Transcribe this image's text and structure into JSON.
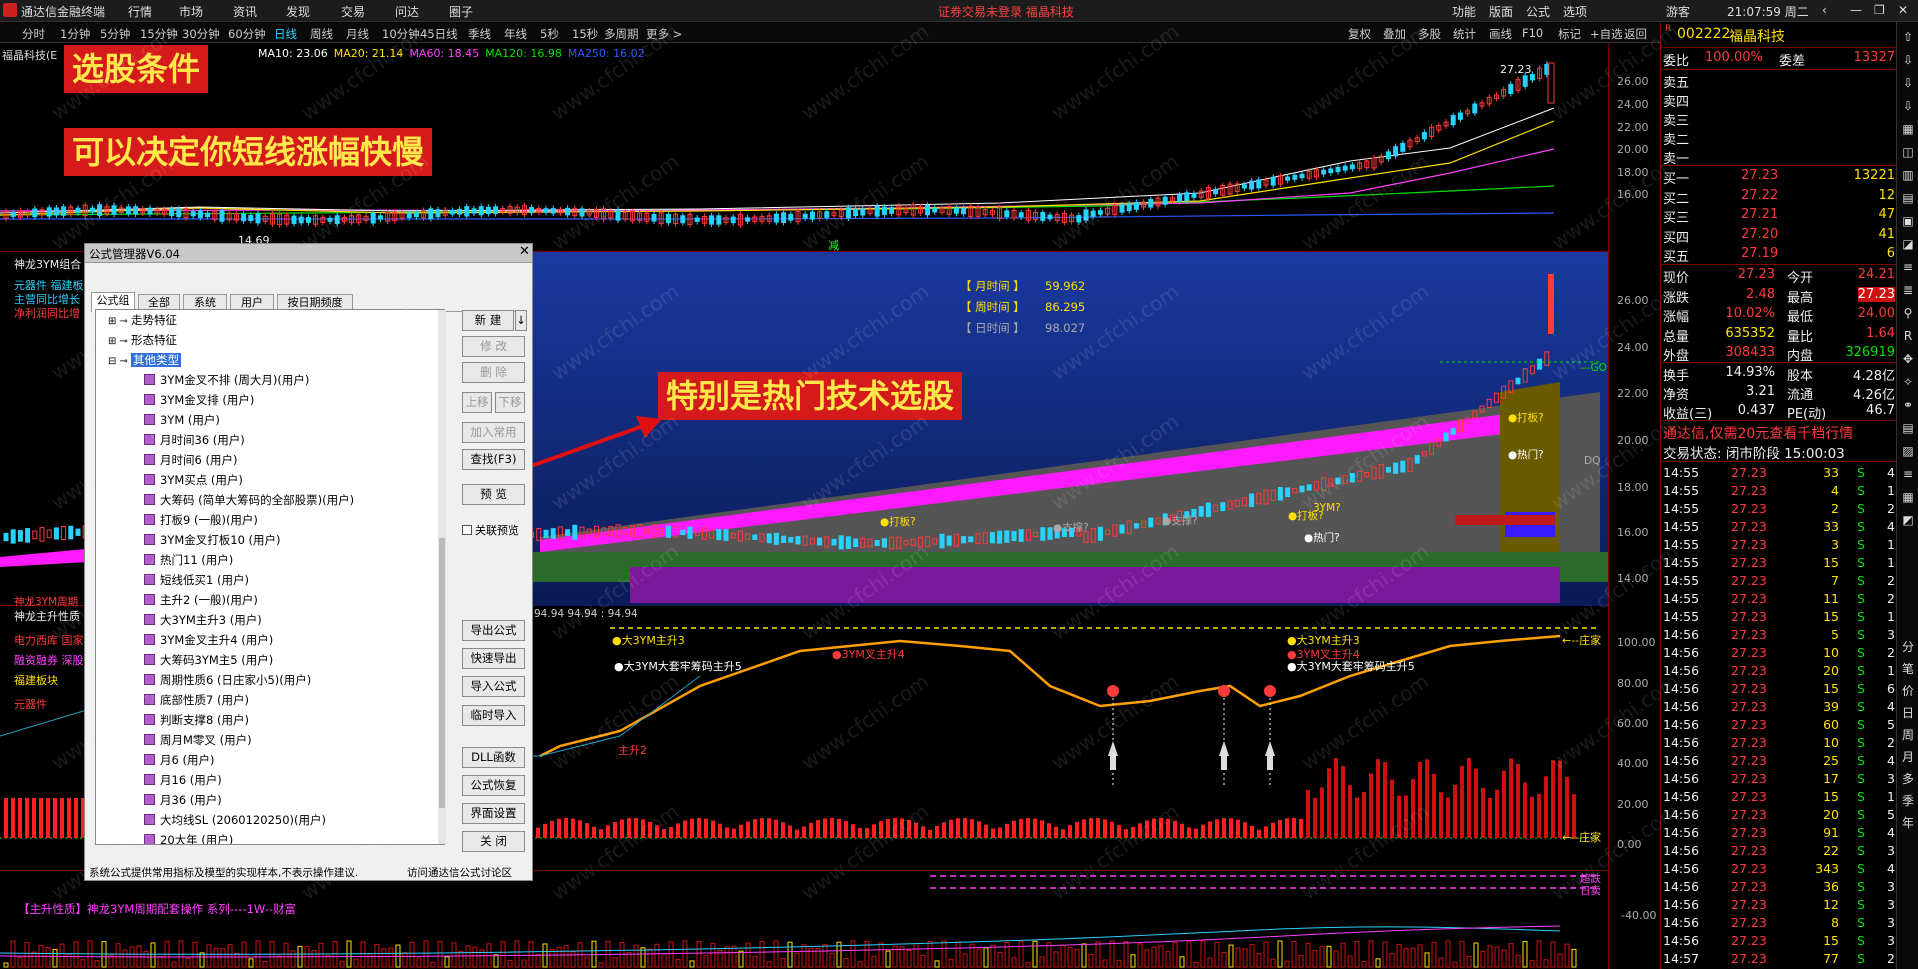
{
  "app": {
    "title": "通达信金融终端",
    "menu": [
      "行情",
      "市场",
      "资讯",
      "发现",
      "交易",
      "问达",
      "圈子"
    ],
    "center_notice": "证券交易未登录  福晶科技",
    "right_menu": [
      "功能",
      "版面",
      "公式",
      "选项"
    ],
    "user": "游客",
    "clock": "21:07:59 周二"
  },
  "periods": [
    "分时",
    "1分钟",
    "5分钟",
    "15分钟",
    "30分钟",
    "60分钟",
    "日线",
    "周线",
    "月线",
    "10分钟",
    "45日线",
    "季线",
    "年线",
    "5秒",
    "15秒",
    "多周期",
    "更多 >"
  ],
  "active_period": "日线",
  "toolbar_right": [
    "复权",
    "叠加",
    "多股",
    "统计",
    "画线",
    "F10",
    "标记",
    "+自选",
    "返回"
  ],
  "main_chart": {
    "legend_stock": "福晶科技(E",
    "ma_legend": [
      {
        "text": "MA10: 23.06",
        "color": "#ffffff"
      },
      {
        "text": "MA20: 21.14",
        "color": "#ffe000"
      },
      {
        "text": "MA60: 18.45",
        "color": "#ff40ff"
      },
      {
        "text": "MA120: 16.98",
        "color": "#00e000"
      },
      {
        "text": "MA250: 16.02",
        "color": "#2a5aff"
      }
    ],
    "y_ticks": [
      "26.00",
      "24.00",
      "22.00",
      "20.00",
      "18.00",
      "16.00"
    ],
    "high_label": "27.23",
    "low_label": "14.69",
    "reduce_mark": "减"
  },
  "panel2": {
    "title": "神龙3YM组合",
    "info_lines": [
      "元器件 福建板",
      "主营同比增长",
      "净利润同比增"
    ],
    "time_labels": [
      {
        "name": "【 月时间 】",
        "value": "59.962",
        "color": "#ffe000"
      },
      {
        "name": "【 周时间 】",
        "value": "86.295",
        "color": "#ffe000"
      },
      {
        "name": "【 日时间 】",
        "value": "98.027",
        "color": "#aaaaaa"
      }
    ],
    "y_ticks": [
      "26.00",
      "24.00",
      "22.00",
      "20.00",
      "18.00",
      "16.00",
      "14.00"
    ],
    "markers": [
      "●打板?",
      "●打板?",
      "●支撑?",
      "●支撑?",
      "●打板?",
      "●热门?",
      "3YM?",
      "●热门?",
      "●打板?"
    ],
    "go_label": "—GO",
    "dq_label": "DQ",
    "cycle_label": "神龙3YM周期",
    "bottom_readout": "94.94  94.94 : 94.94"
  },
  "panel3": {
    "title": "神龙主升性质",
    "side_labels": [
      "电力西库 国家",
      "融资融券 深股",
      "福建板块",
      "元器件"
    ],
    "annotations": [
      "●大3YM主升3",
      "●大3YM大套牢筹码主升5",
      "●3YM叉主升4",
      "●大3YM主升3",
      "●3YM叉主升4",
      "●大3YM大套牢筹码主升5",
      "主升2"
    ],
    "y_ticks": [
      "100.00",
      "80.00",
      "60.00",
      "40.00",
      "20.00",
      "0.00"
    ],
    "zhuangjia_top": "←--庄家",
    "zhuangjia_bottom": "←--庄家"
  },
  "panel4": {
    "title": "【主升性质】神龙3YM周期配套操作 系列----1W--财富",
    "y_ticks": [
      "-40.00"
    ],
    "labels": [
      "超跌",
      "日卖"
    ]
  },
  "banners": {
    "b1": "选股条件",
    "b2": "可以决定你短线涨幅快慢",
    "b3": "特别是热门技术选股"
  },
  "dialog": {
    "title": "公式管理器V6.04",
    "tabs": [
      "公式组",
      "全部",
      "系统",
      "用户",
      "按日期频度"
    ],
    "tree_groups": [
      "走势特征",
      "形态特征",
      "其他类型"
    ],
    "items": [
      "3YM金叉不排 (周大月)(用户)",
      "3YM金叉排 (用户)",
      "3YM (用户)",
      "月时间36 (用户)",
      "月时间6 (用户)",
      "3YM买点 (用户)",
      "大筹码 (简单大筹码的全部股票)(用户)",
      "打板9 (一般)(用户)",
      "3YM金叉打板10 (用户)",
      "热门11 (用户)",
      "短线低买1 (用户)",
      "主升2 (一般)(用户)",
      "大3YM主升3 (用户)",
      "3YM金叉主升4 (用户)",
      "大筹码3YM主5 (用户)",
      "周期性质6 (日庄家小5)(用户)",
      "底部性质7 (用户)",
      "判断支撑8 (用户)",
      "周月M零叉 (用户)",
      "月6 (用户)",
      "月16 (用户)",
      "月36 (用户)",
      "大均线SL (2060120250)(用户)",
      "20大年 (用户)"
    ],
    "buttons_top": [
      "新 建",
      "修 改",
      "删 除",
      "上移",
      "下移",
      "加入常用",
      "查找(F3)",
      "预 览"
    ],
    "checkbox": "关联预览",
    "buttons_bottom": [
      "导出公式",
      "快速导出",
      "导入公式",
      "临时导入",
      "DLL函数",
      "公式恢复",
      "界面设置",
      "关 闭"
    ],
    "footer_left": "系统公式提供常用指标及模型的实现样本,不表示操作建议.",
    "footer_right": "访问通达信公式讨论区"
  },
  "quote": {
    "code": "002222",
    "name": "福晶科技",
    "market_tag": "R",
    "weibi": {
      "label": "委比",
      "value": "100.00%",
      "label2": "委差",
      "value2": "13327"
    },
    "sell": [
      {
        "label": "卖五",
        "price": "",
        "vol": ""
      },
      {
        "label": "卖四",
        "price": "",
        "vol": ""
      },
      {
        "label": "卖三",
        "price": "",
        "vol": ""
      },
      {
        "label": "卖二",
        "price": "",
        "vol": ""
      },
      {
        "label": "卖一",
        "price": "",
        "vol": ""
      }
    ],
    "buy": [
      {
        "label": "买一",
        "price": "27.23",
        "vol": "13221"
      },
      {
        "label": "买二",
        "price": "27.22",
        "vol": "12"
      },
      {
        "label": "买三",
        "price": "27.21",
        "vol": "47"
      },
      {
        "label": "买四",
        "price": "27.20",
        "vol": "41"
      },
      {
        "label": "买五",
        "price": "27.19",
        "vol": "6"
      }
    ],
    "stats": [
      {
        "l1": "现价",
        "v1": "27.23",
        "l2": "今开",
        "v2": "24.21",
        "c1": "#ff3a3a",
        "c2": "#ff3a3a"
      },
      {
        "l1": "涨跌",
        "v1": "2.48",
        "l2": "最高",
        "v2": "27.23",
        "c1": "#ff3a3a",
        "c2": "#ff3a3a"
      },
      {
        "l1": "涨幅",
        "v1": "10.02%",
        "l2": "最低",
        "v2": "24.00",
        "c1": "#ff3a3a",
        "c2": "#ff3a3a"
      },
      {
        "l1": "总量",
        "v1": "635352",
        "l2": "量比",
        "v2": "1.64",
        "c1": "#ffe000",
        "c2": "#ff3a3a"
      },
      {
        "l1": "外盘",
        "v1": "308433",
        "l2": "内盘",
        "v2": "326919",
        "c1": "#ff3a3a",
        "c2": "#00e000"
      }
    ],
    "stats2": [
      {
        "l1": "换手",
        "v1": "14.93%",
        "l2": "股本",
        "v2": "4.28亿"
      },
      {
        "l1": "净资",
        "v1": "3.21",
        "l2": "流通",
        "v2": "4.26亿"
      },
      {
        "l1": "收益(三)",
        "v1": "0.437",
        "l2": "PE(动)",
        "v2": "46.7"
      }
    ],
    "ad": "通达信,仅需20元查看千档行情",
    "trade_status": "交易状态: 闭市阶段 15:00:03",
    "ticks": [
      {
        "t": "14:55",
        "p": "27.23",
        "v": "33",
        "s": "S",
        "n": "4"
      },
      {
        "t": "14:55",
        "p": "27.23",
        "v": "4",
        "s": "S",
        "n": "1"
      },
      {
        "t": "14:55",
        "p": "27.23",
        "v": "2",
        "s": "S",
        "n": "2"
      },
      {
        "t": "14:55",
        "p": "27.23",
        "v": "33",
        "s": "S",
        "n": "4"
      },
      {
        "t": "14:55",
        "p": "27.23",
        "v": "3",
        "s": "S",
        "n": "1"
      },
      {
        "t": "14:55",
        "p": "27.23",
        "v": "15",
        "s": "S",
        "n": "1"
      },
      {
        "t": "14:55",
        "p": "27.23",
        "v": "7",
        "s": "S",
        "n": "2"
      },
      {
        "t": "14:55",
        "p": "27.23",
        "v": "11",
        "s": "S",
        "n": "2"
      },
      {
        "t": "14:55",
        "p": "27.23",
        "v": "15",
        "s": "S",
        "n": "1"
      },
      {
        "t": "14:56",
        "p": "27.23",
        "v": "5",
        "s": "S",
        "n": "3"
      },
      {
        "t": "14:56",
        "p": "27.23",
        "v": "10",
        "s": "S",
        "n": "2"
      },
      {
        "t": "14:56",
        "p": "27.23",
        "v": "20",
        "s": "S",
        "n": "1"
      },
      {
        "t": "14:56",
        "p": "27.23",
        "v": "15",
        "s": "S",
        "n": "6"
      },
      {
        "t": "14:56",
        "p": "27.23",
        "v": "39",
        "s": "S",
        "n": "4"
      },
      {
        "t": "14:56",
        "p": "27.23",
        "v": "60",
        "s": "S",
        "n": "5"
      },
      {
        "t": "14:56",
        "p": "27.23",
        "v": "10",
        "s": "S",
        "n": "2"
      },
      {
        "t": "14:56",
        "p": "27.23",
        "v": "25",
        "s": "S",
        "n": "4"
      },
      {
        "t": "14:56",
        "p": "27.23",
        "v": "17",
        "s": "S",
        "n": "3"
      },
      {
        "t": "14:56",
        "p": "27.23",
        "v": "15",
        "s": "S",
        "n": "1"
      },
      {
        "t": "14:56",
        "p": "27.23",
        "v": "20",
        "s": "S",
        "n": "5"
      },
      {
        "t": "14:56",
        "p": "27.23",
        "v": "91",
        "s": "S",
        "n": "4"
      },
      {
        "t": "14:56",
        "p": "27.23",
        "v": "22",
        "s": "S",
        "n": "3"
      },
      {
        "t": "14:56",
        "p": "27.23",
        "v": "343",
        "s": "S",
        "n": "4"
      },
      {
        "t": "14:56",
        "p": "27.23",
        "v": "36",
        "s": "S",
        "n": "3"
      },
      {
        "t": "14:56",
        "p": "27.23",
        "v": "12",
        "s": "S",
        "n": "3"
      },
      {
        "t": "14:56",
        "p": "27.23",
        "v": "8",
        "s": "S",
        "n": "3"
      },
      {
        "t": "14:56",
        "p": "27.23",
        "v": "15",
        "s": "S",
        "n": "3"
      },
      {
        "t": "14:57",
        "p": "27.23",
        "v": "77",
        "s": "S",
        "n": "2"
      }
    ]
  },
  "sidebar": [
    "分",
    "笔",
    "价",
    "日",
    "周",
    "月",
    "多",
    "季",
    "年"
  ],
  "watermark": "www.cfchi.com"
}
